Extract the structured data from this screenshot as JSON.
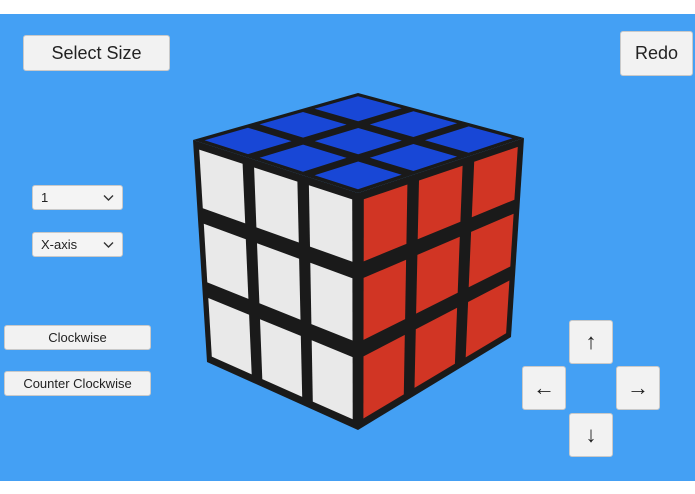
{
  "toolbar": {
    "select_size_label": "Select Size",
    "redo_label": "Redo"
  },
  "controls": {
    "layer_select": {
      "value": "1"
    },
    "axis_select": {
      "value": "X-axis"
    },
    "clockwise_label": "Clockwise",
    "counter_clockwise_label": "Counter Clockwise"
  },
  "arrows": {
    "up": "↑",
    "left": "←",
    "right": "→",
    "down": "↓"
  },
  "cube": {
    "size": 3,
    "faces": {
      "top": "blue",
      "front": "white",
      "right": "red"
    },
    "colors": {
      "blue": "#1847d6",
      "white": "#e9e9e9",
      "red": "#d13524",
      "edge": "#1a1a1a",
      "background": "#44a0f4"
    }
  }
}
